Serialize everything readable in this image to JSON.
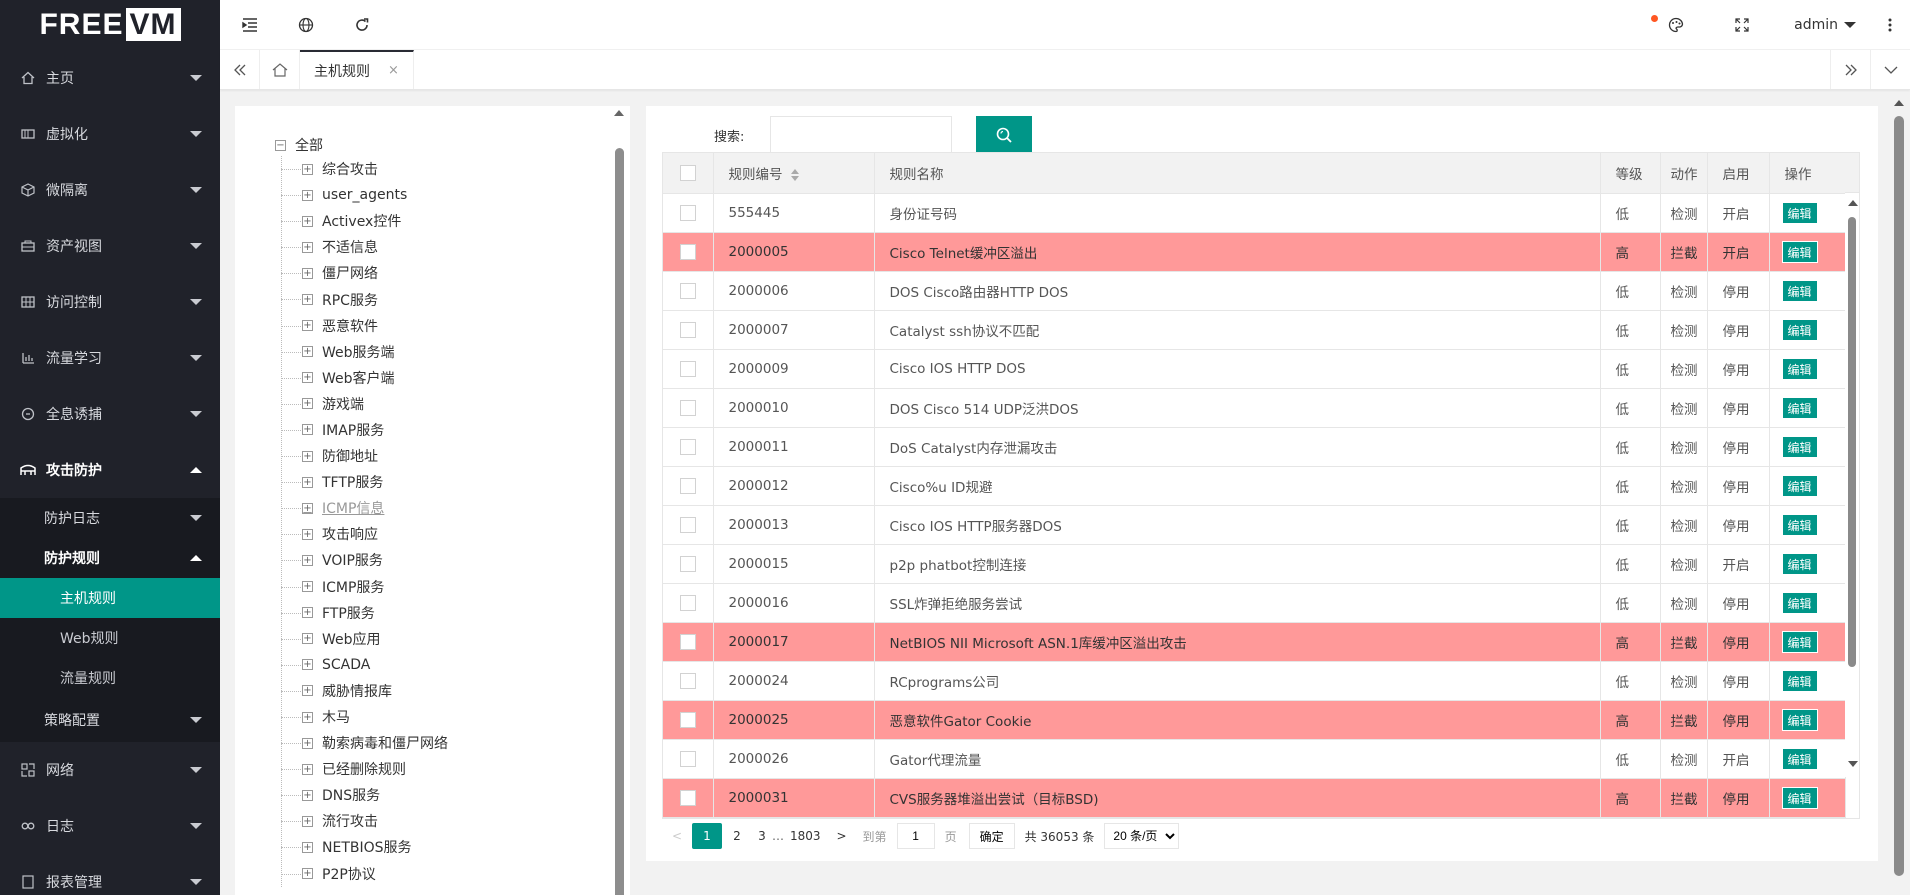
{
  "logo": {
    "free": "FREE",
    "vm": "VM"
  },
  "sidebar": {
    "items": [
      {
        "label": "主页",
        "icon": "home-icon"
      },
      {
        "label": "虚拟化",
        "icon": "server-icon"
      },
      {
        "label": "微隔离",
        "icon": "cube-icon"
      },
      {
        "label": "资产视图",
        "icon": "assets-icon"
      },
      {
        "label": "访问控制",
        "icon": "grid-icon"
      },
      {
        "label": "流量学习",
        "icon": "chart-icon"
      },
      {
        "label": "全息诱捕",
        "icon": "trap-icon"
      },
      {
        "label": "攻击防护",
        "icon": "shield-icon"
      }
    ],
    "attack": {
      "log": "防护日志",
      "rules": "防护规则",
      "host_rules": "主机规则",
      "web_rules": "Web规则",
      "flow_rules": "流量规则",
      "policy": "策略配置"
    },
    "bottom": [
      {
        "label": "网络",
        "icon": "network-icon"
      },
      {
        "label": "日志",
        "icon": "link-icon"
      },
      {
        "label": "报表管理",
        "icon": "report-icon"
      }
    ]
  },
  "header": {
    "user": "admin"
  },
  "tabs": {
    "current": "主机规则",
    "close": "×"
  },
  "tree": {
    "root": "全部",
    "nodes": [
      "综合攻击",
      "user_agents",
      "Activex控件",
      "不适信息",
      "僵尸网络",
      "RPC服务",
      "恶意软件",
      "Web服务端",
      "Web客户端",
      "游戏端",
      "IMAP服务",
      "防御地址",
      "TFTP服务",
      "ICMP信息",
      "攻击响应",
      "VOIP服务",
      "ICMP服务",
      "FTP服务",
      "Web应用",
      "SCADA",
      "威胁情报库",
      "木马",
      "勒索病毒和僵尸网络",
      "已经删除规则",
      "DNS服务",
      "流行攻击",
      "NETBIOS服务",
      "P2P协议"
    ]
  },
  "search": {
    "label": "搜索:",
    "value": ""
  },
  "table": {
    "headers": {
      "id": "规则编号",
      "name": "规则名称",
      "level": "等级",
      "action": "动作",
      "enabled": "启用",
      "op": "操作"
    },
    "edit_label": "编辑",
    "rows": [
      {
        "id": "555445",
        "name": "身份证号码",
        "level": "低",
        "action": "检测",
        "enabled": "开启",
        "danger": false
      },
      {
        "id": "2000005",
        "name": "Cisco Telnet缓冲区溢出",
        "level": "高",
        "action": "拦截",
        "enabled": "开启",
        "danger": true
      },
      {
        "id": "2000006",
        "name": "DOS Cisco路由器HTTP DOS",
        "level": "低",
        "action": "检测",
        "enabled": "停用",
        "danger": false
      },
      {
        "id": "2000007",
        "name": "Catalyst ssh协议不匹配",
        "level": "低",
        "action": "检测",
        "enabled": "停用",
        "danger": false
      },
      {
        "id": "2000009",
        "name": "Cisco IOS HTTP DOS",
        "level": "低",
        "action": "检测",
        "enabled": "停用",
        "danger": false
      },
      {
        "id": "2000010",
        "name": "DOS Cisco 514 UDP泛洪DOS",
        "level": "低",
        "action": "检测",
        "enabled": "停用",
        "danger": false
      },
      {
        "id": "2000011",
        "name": "DoS Catalyst内存泄漏攻击",
        "level": "低",
        "action": "检测",
        "enabled": "停用",
        "danger": false
      },
      {
        "id": "2000012",
        "name": "Cisco%u ID规避",
        "level": "低",
        "action": "检测",
        "enabled": "停用",
        "danger": false
      },
      {
        "id": "2000013",
        "name": "Cisco IOS HTTP服务器DOS",
        "level": "低",
        "action": "检测",
        "enabled": "停用",
        "danger": false
      },
      {
        "id": "2000015",
        "name": "p2p phatbot控制连接",
        "level": "低",
        "action": "检测",
        "enabled": "开启",
        "danger": false
      },
      {
        "id": "2000016",
        "name": "SSL炸弹拒绝服务尝试",
        "level": "低",
        "action": "检测",
        "enabled": "停用",
        "danger": false
      },
      {
        "id": "2000017",
        "name": "NetBIOS NII Microsoft ASN.1库缓冲区溢出攻击",
        "level": "高",
        "action": "拦截",
        "enabled": "停用",
        "danger": true
      },
      {
        "id": "2000024",
        "name": "RCprograms公司",
        "level": "低",
        "action": "检测",
        "enabled": "停用",
        "danger": false
      },
      {
        "id": "2000025",
        "name": "恶意软件Gator Cookie",
        "level": "高",
        "action": "拦截",
        "enabled": "停用",
        "danger": true
      },
      {
        "id": "2000026",
        "name": "Gator代理流量",
        "level": "低",
        "action": "检测",
        "enabled": "开启",
        "danger": false
      },
      {
        "id": "2000031",
        "name": "CVS服务器堆溢出尝试（目标BSD)",
        "level": "高",
        "action": "拦截",
        "enabled": "停用",
        "danger": true
      }
    ]
  },
  "pager": {
    "prev": "<",
    "p1": "1",
    "p2": "2",
    "p3": "3",
    "ellipsis": "…",
    "last": "1803",
    "next": ">",
    "goto": "到第",
    "goto_value": "1",
    "page_unit": "页",
    "ok": "确定",
    "total": "共 36053 条",
    "per_page": "20 条/页"
  },
  "colors": {
    "accent": "#009688",
    "danger_row": "#ff9999",
    "sidebar_bg": "#20222a"
  }
}
